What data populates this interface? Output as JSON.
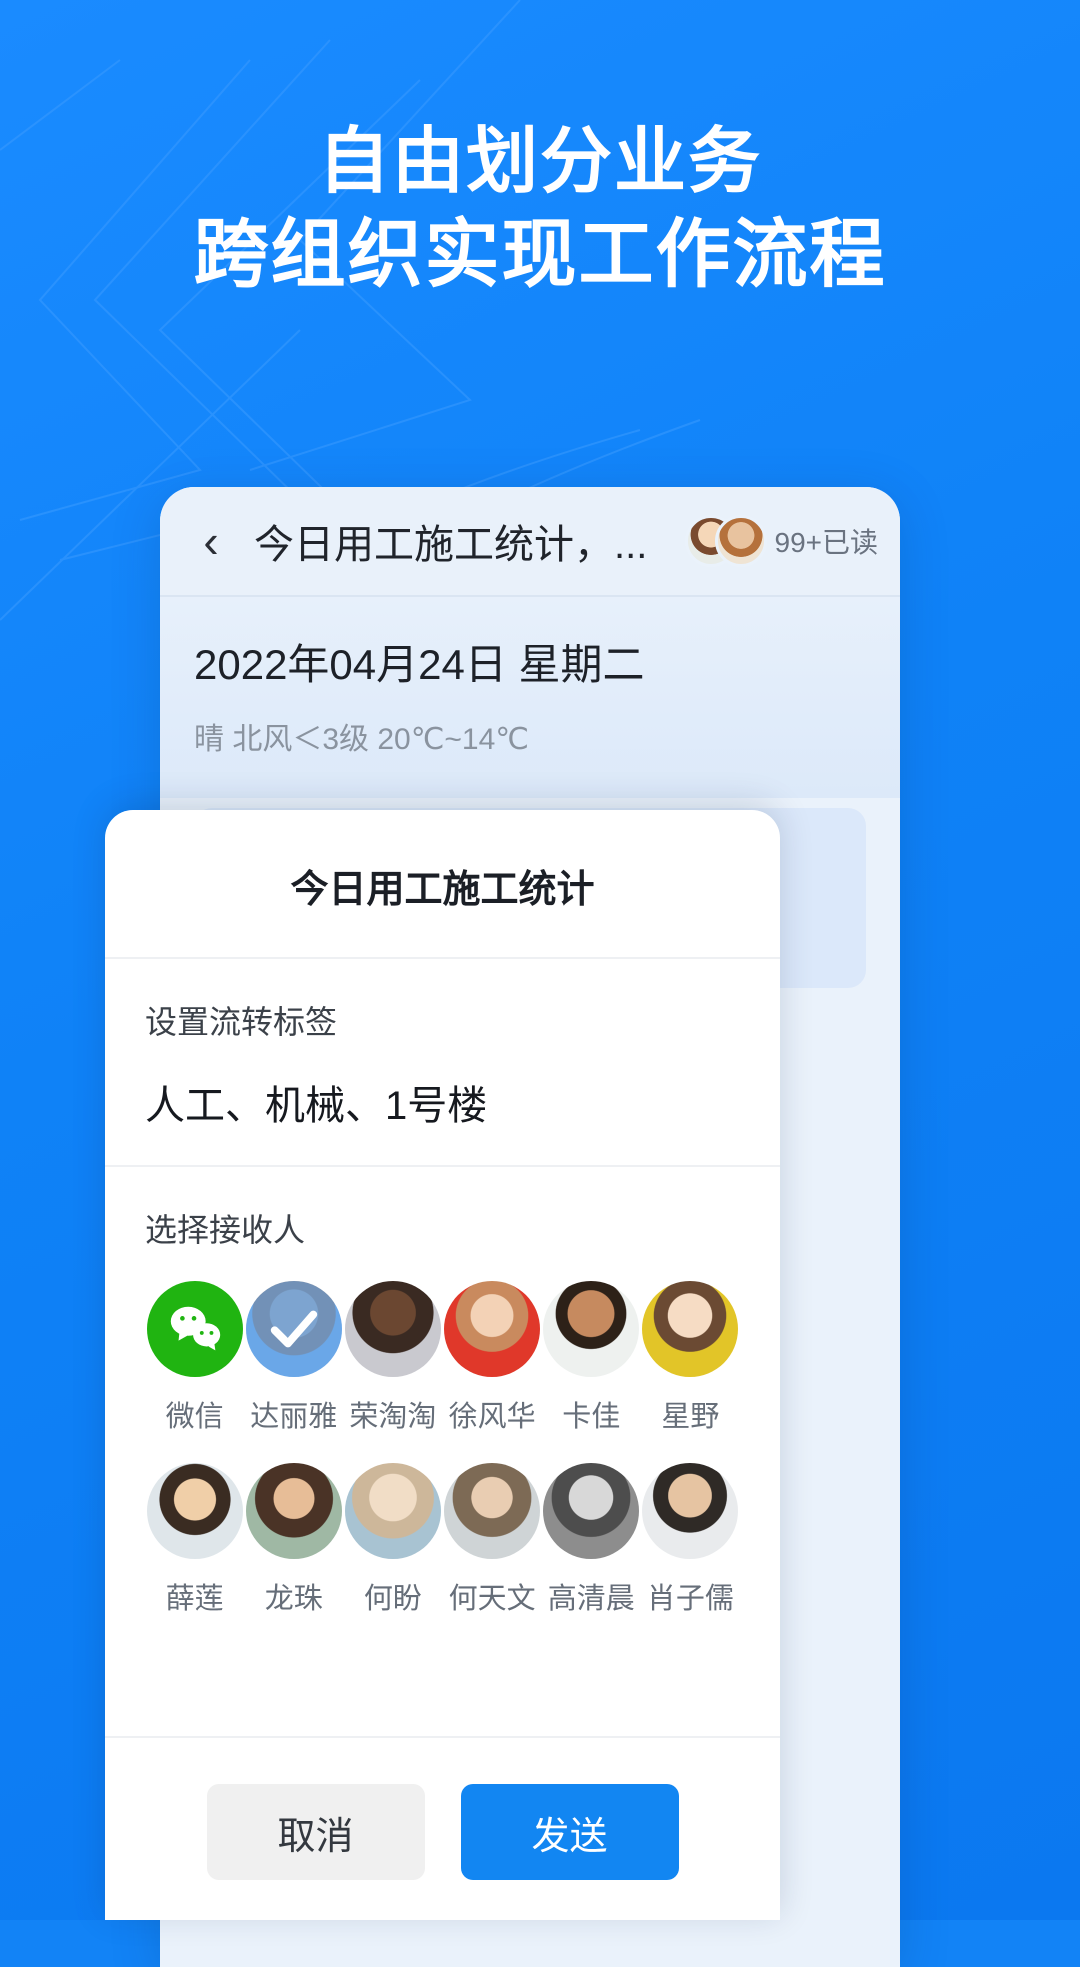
{
  "theme": {
    "brand_blue": "#1286f2",
    "bg_blue": "#1283f6",
    "wechat_green": "#20b411"
  },
  "headline": {
    "line1": "自由划分业务",
    "line2": "跨组织实现工作流程"
  },
  "phone": {
    "nav": {
      "back_icon": "chevron-left-icon",
      "title": "今日用工施工统计，...",
      "read_label": "99+已读"
    },
    "date_card": {
      "date": "2022年04月24日 星期二",
      "weather": "晴 北风＜3级 20℃~14℃"
    }
  },
  "modal": {
    "title": "今日用工施工统计",
    "tag_label": "设置流转标签",
    "tag_value": "人工、机械、1号楼",
    "recipients_label": "选择接收人",
    "recipients": [
      {
        "name": "微信",
        "type": "wechat",
        "selected": false
      },
      {
        "name": "达丽雅",
        "type": "photo",
        "selected": true
      },
      {
        "name": "荣淘淘",
        "type": "photo",
        "selected": false
      },
      {
        "name": "徐风华",
        "type": "photo",
        "selected": false
      },
      {
        "name": "卡佳",
        "type": "photo",
        "selected": false
      },
      {
        "name": "星野",
        "type": "photo",
        "selected": false
      },
      {
        "name": "薛莲",
        "type": "photo",
        "selected": false
      },
      {
        "name": "龙珠",
        "type": "photo",
        "selected": false
      },
      {
        "name": "何盼",
        "type": "photo",
        "selected": false
      },
      {
        "name": "何天文",
        "type": "photo",
        "selected": false
      },
      {
        "name": "高清晨",
        "type": "photo",
        "selected": false
      },
      {
        "name": "肖子儒",
        "type": "photo",
        "selected": false
      }
    ],
    "cancel_label": "取消",
    "send_label": "发送"
  }
}
